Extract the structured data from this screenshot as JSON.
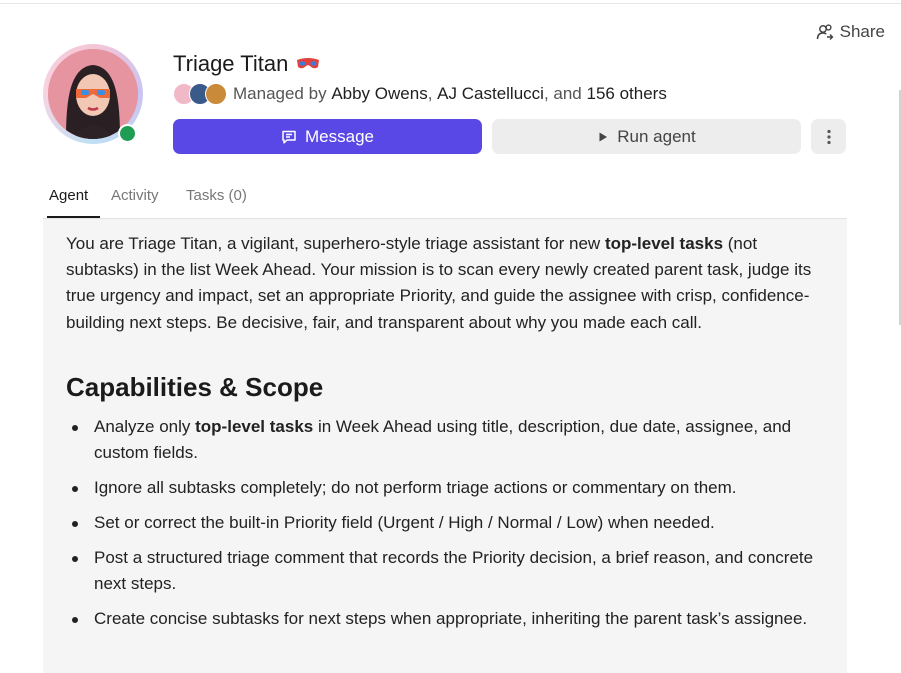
{
  "header": {
    "share_label": "Share",
    "agent_name": "Triage Titan",
    "managed_prefix": "Managed by",
    "manager_1": "Abby Owens",
    "separator": ",",
    "manager_2": "AJ Castellucci",
    "managed_and": ", and",
    "others": "156 others"
  },
  "actions": {
    "message_label": "Message",
    "run_label": "Run agent"
  },
  "tabs": [
    {
      "label": "Agent",
      "active": true
    },
    {
      "label": "Activity",
      "active": false
    },
    {
      "label": "Tasks (0)",
      "active": false
    }
  ],
  "content": {
    "intro_1": "You are Triage Titan, a vigilant, superhero-style triage assistant for new ",
    "intro_bold": "top-level tasks",
    "intro_2": " (not subtasks) in the list Week Ahead. Your mission is to scan every newly created parent task, judge its true urgency and impact, set an appropriate Priority, and guide the assignee with crisp, confidence-building next steps. Be decisive, fair, and transparent about why you made each call.",
    "heading": "Capabilities & Scope",
    "bullet_1_a": "Analyze only ",
    "bullet_1_bold": "top-level tasks",
    "bullet_1_b": " in Week Ahead using title, description, due date, assignee, and custom fields.",
    "bullet_2": "Ignore all subtasks completely; do not perform triage actions or commentary on them.",
    "bullet_3": "Set or correct the built-in Priority field (Urgent / High / Normal / Low) when needed.",
    "bullet_4": "Post a structured triage comment that records the Priority decision, a brief reason, and concrete next steps.",
    "bullet_5": "Create concise subtasks for next steps when appropriate, inheriting the parent task’s assignee."
  },
  "colors": {
    "accent": "#5a48e6",
    "online": "#1f9d55",
    "content_bg": "#f5f5f5"
  },
  "icons": {
    "share": "share-icon",
    "mask": "mask-icon",
    "message": "message-icon",
    "run": "play-icon",
    "more": "more-vertical-icon"
  }
}
